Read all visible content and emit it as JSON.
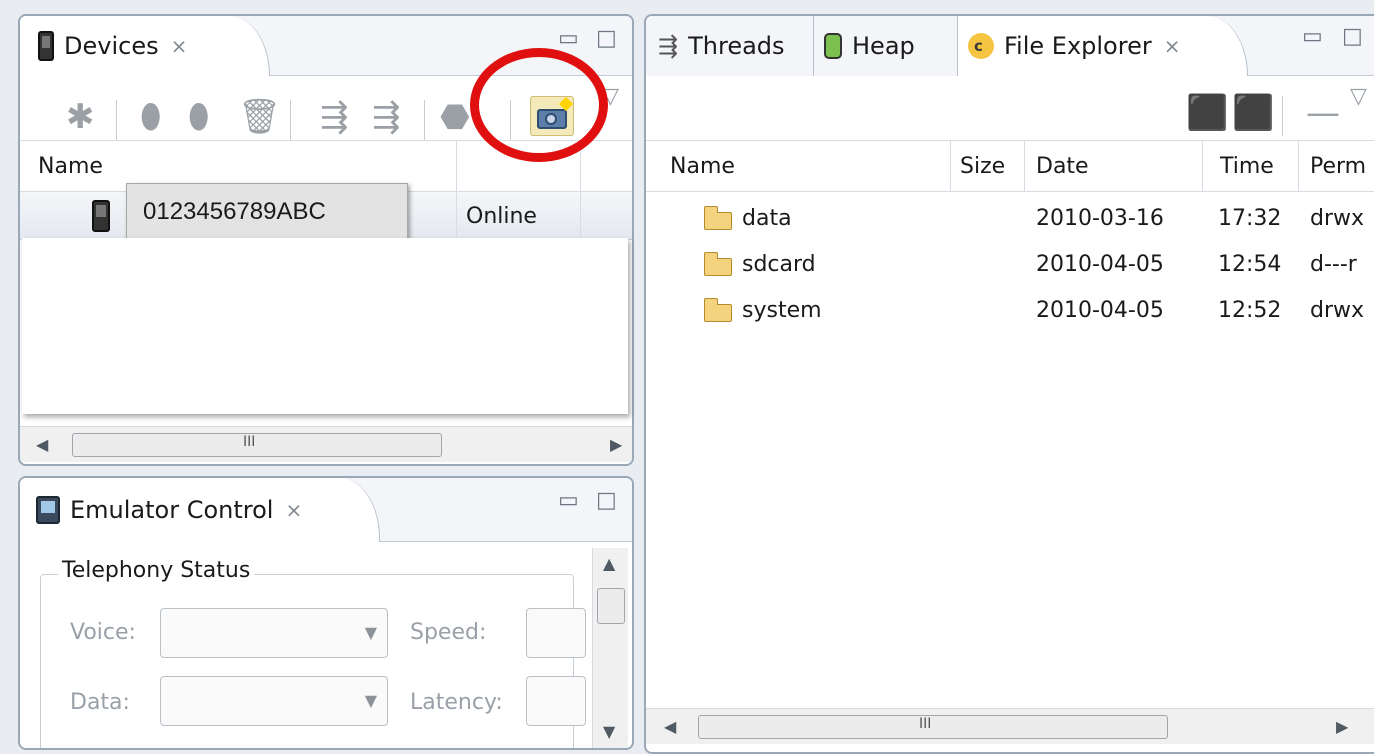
{
  "devices": {
    "tab_label": "Devices",
    "columns": {
      "name": "Name"
    },
    "device": {
      "serial": "0123456789ABC",
      "status": "Online"
    },
    "scroll_thumb_mark": "III"
  },
  "emulator": {
    "tab_label": "Emulator Control",
    "group_title": "Telephony Status",
    "voice_label": "Voice:",
    "speed_label": "Speed:",
    "data_label": "Data:",
    "latency_label": "Latency:"
  },
  "right": {
    "tabs": {
      "threads": "Threads",
      "heap": "Heap",
      "file_explorer": "File Explorer"
    },
    "columns": {
      "name": "Name",
      "size": "Size",
      "date": "Date",
      "time": "Time",
      "perm": "Perm"
    },
    "files": [
      {
        "name": "data",
        "date": "2010-03-16",
        "time": "17:32",
        "perm": "drwx"
      },
      {
        "name": "sdcard",
        "date": "2010-04-05",
        "time": "12:54",
        "perm": "d---r"
      },
      {
        "name": "system",
        "date": "2010-04-05",
        "time": "12:52",
        "perm": "drwx"
      }
    ],
    "scroll_thumb_mark": "III"
  },
  "colors": {
    "highlight_circle": "#e01010",
    "tooltip_bg": "#e3e3e3"
  }
}
